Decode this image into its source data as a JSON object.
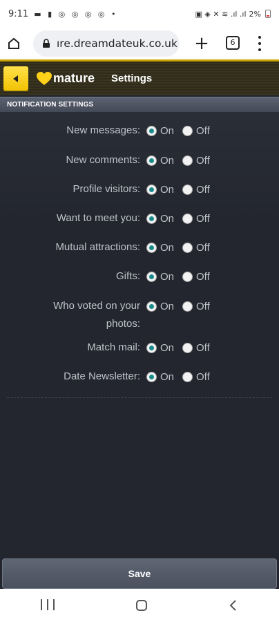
{
  "status_bar": {
    "time": "9:11",
    "battery": "2%"
  },
  "browser": {
    "url": "ıre.dreamdateuk.co.uk",
    "tab_count": "6"
  },
  "header": {
    "logo_text": "mature",
    "title": "Settings"
  },
  "section": {
    "title": "NOTIFICATION SETTINGS"
  },
  "settings": [
    {
      "label": "New messages:",
      "on": "On",
      "off": "Off",
      "selected": "On"
    },
    {
      "label": "New comments:",
      "on": "On",
      "off": "Off",
      "selected": "On"
    },
    {
      "label": "Profile visitors:",
      "on": "On",
      "off": "Off",
      "selected": "On"
    },
    {
      "label": "Want to meet you:",
      "on": "On",
      "off": "Off",
      "selected": "On"
    },
    {
      "label": "Mutual attractions:",
      "on": "On",
      "off": "Off",
      "selected": "On"
    },
    {
      "label": "Gifts:",
      "on": "On",
      "off": "Off",
      "selected": "On"
    },
    {
      "label": "Who voted on your photos:",
      "on": "On",
      "off": "Off",
      "selected": "On"
    },
    {
      "label": "Match mail:",
      "on": "On",
      "off": "Off",
      "selected": "On"
    },
    {
      "label": "Date Newsletter:",
      "on": "On",
      "off": "Off",
      "selected": "On"
    }
  ],
  "save_label": "Save",
  "colors": {
    "accent_yellow": "#f2c200",
    "radio_selected": "#1a8a8a",
    "background": "#23262e"
  }
}
